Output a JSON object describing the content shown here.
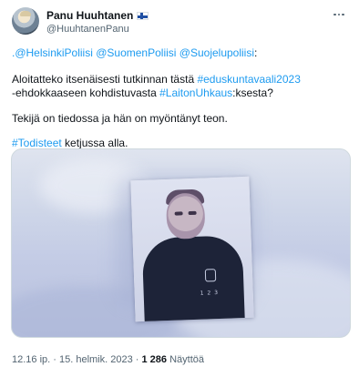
{
  "author": {
    "display_name": "Panu Huuhtanen",
    "handle": "@HuuhtanenPanu",
    "flag_icon": "finland-flag-icon",
    "avatar_icon": "profile-avatar"
  },
  "more_icon": "more-options-icon",
  "tweet": {
    "mentions": [
      ".@HelsinkiPoliisi",
      "@SuomenPoliisi",
      "@Suojelupoliisi",
      ":"
    ],
    "line2_prefix": "Aloitatteko itsenäisesti tutkinnan tästä ",
    "line2_hashtag": "#eduskuntavaali2023",
    "line3_prefix": "-ehdokkaaseen kohdistuvasta ",
    "line3_hashtag": "#LaitonUhkaus",
    "line3_suffix": ":ksesta?",
    "line4": "Tekijä on tiedossa ja hän on myöntänyt teon.",
    "line5_hashtag": "#Todisteet",
    "line5_suffix": " ketjussa alla."
  },
  "media": {
    "description_icon": "photo-poster-in-snow"
  },
  "meta": {
    "time": "12.16 ip.",
    "separator": " · ",
    "date": "15. helmik. 2023",
    "views_count": "1 286",
    "views_label": " Näyttöä"
  },
  "colors": {
    "link": "#1d9bf0",
    "text": "#0f1419",
    "secondary": "#536471"
  }
}
